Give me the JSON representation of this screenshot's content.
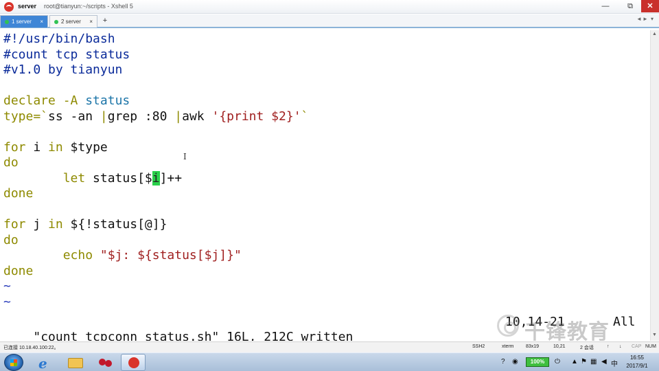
{
  "window": {
    "title": "server",
    "subtitle": "root@tianyun:~/scripts - Xshell 5",
    "min_glyph": "—",
    "max_glyph": "⧉",
    "close_glyph": "✕"
  },
  "tabs": [
    {
      "label": "1 server",
      "active": true,
      "close_glyph": "×"
    },
    {
      "label": "2 server",
      "active": false,
      "close_glyph": "×"
    }
  ],
  "tab_add_glyph": "+",
  "tab_nav": {
    "prev": "◄",
    "next": "►",
    "menu": "▾"
  },
  "editor": {
    "lines": [
      [
        {
          "t": "#!/usr/bin/bash",
          "c": "comment"
        }
      ],
      [
        {
          "t": "#count tcp status",
          "c": "comment"
        }
      ],
      [
        {
          "t": "#v1.0 by tianyun",
          "c": "comment"
        }
      ],
      [],
      [
        {
          "t": "declare -A ",
          "c": "key"
        },
        {
          "t": "status",
          "c": "var"
        }
      ],
      [
        {
          "t": "type=`",
          "c": "key"
        },
        {
          "t": "ss -an ",
          "c": "norm"
        },
        {
          "t": "|",
          "c": "key"
        },
        {
          "t": "grep :80 ",
          "c": "norm"
        },
        {
          "t": "|",
          "c": "key"
        },
        {
          "t": "awk ",
          "c": "norm"
        },
        {
          "t": "'{print $2}'",
          "c": "str"
        },
        {
          "t": "`",
          "c": "key"
        }
      ],
      [],
      [
        {
          "t": "for",
          "c": "key"
        },
        {
          "t": " i ",
          "c": "norm"
        },
        {
          "t": "in",
          "c": "key"
        },
        {
          "t": " $type",
          "c": "norm"
        }
      ],
      [
        {
          "t": "do",
          "c": "key"
        }
      ],
      [
        {
          "t": "        let ",
          "c": "key"
        },
        {
          "t": "status[$",
          "c": "norm"
        },
        {
          "t": "i",
          "c": "cursor"
        },
        {
          "t": "]++",
          "c": "norm"
        }
      ],
      [
        {
          "t": "done",
          "c": "key"
        }
      ],
      [],
      [
        {
          "t": "for",
          "c": "key"
        },
        {
          "t": " j ",
          "c": "norm"
        },
        {
          "t": "in",
          "c": "key"
        },
        {
          "t": " ${!status[@]}",
          "c": "norm"
        }
      ],
      [
        {
          "t": "do",
          "c": "key"
        }
      ],
      [
        {
          "t": "        echo ",
          "c": "key"
        },
        {
          "t": "\"$j: ${status[$j]}\"",
          "c": "str"
        }
      ],
      [
        {
          "t": "done",
          "c": "key"
        }
      ],
      [
        {
          "t": "~",
          "c": "tilde"
        }
      ],
      [
        {
          "t": "~",
          "c": "tilde"
        }
      ]
    ],
    "status_message": "\"count_tcpconn_status.sh\" 16L, 212C written",
    "cursor_position": "10,14-21",
    "scroll_indicator": "All",
    "mouse_cursor_glyph": "I"
  },
  "scrollbar": {
    "up_glyph": "▲",
    "down_glyph": "▼"
  },
  "watermark": {
    "text": "千锋教育"
  },
  "statusbar": {
    "connection": "已连接 10.18.40.100:22。",
    "protocol": "SSH2",
    "terminal_type": "xterm",
    "size": "83x19",
    "position": "10,21",
    "sessions": "2 会话",
    "up_glyph": "↑",
    "down_glyph": "↓",
    "cap": "CAP",
    "num": "NUM"
  },
  "taskbar": {
    "battery": "100%",
    "clock_time": "16:55",
    "clock_date": "2017/9/1",
    "help_glyph": "?",
    "qq_glyph": "◉",
    "plug_glyph": "⏻",
    "up_glyph": "▲",
    "flag_glyph": "⚑",
    "net_glyph": "▦",
    "vol_glyph": "◀",
    "ch_glyph": "中",
    "ie_glyph": "e"
  },
  "colors": {
    "comment": "#0b2b9a",
    "keyword": "#8e8a00",
    "variable": "#1c75a8",
    "string": "#a02020",
    "cursor": "#2ad14a",
    "active_tab": "#3f86d6",
    "close_button": "#c9302c"
  }
}
